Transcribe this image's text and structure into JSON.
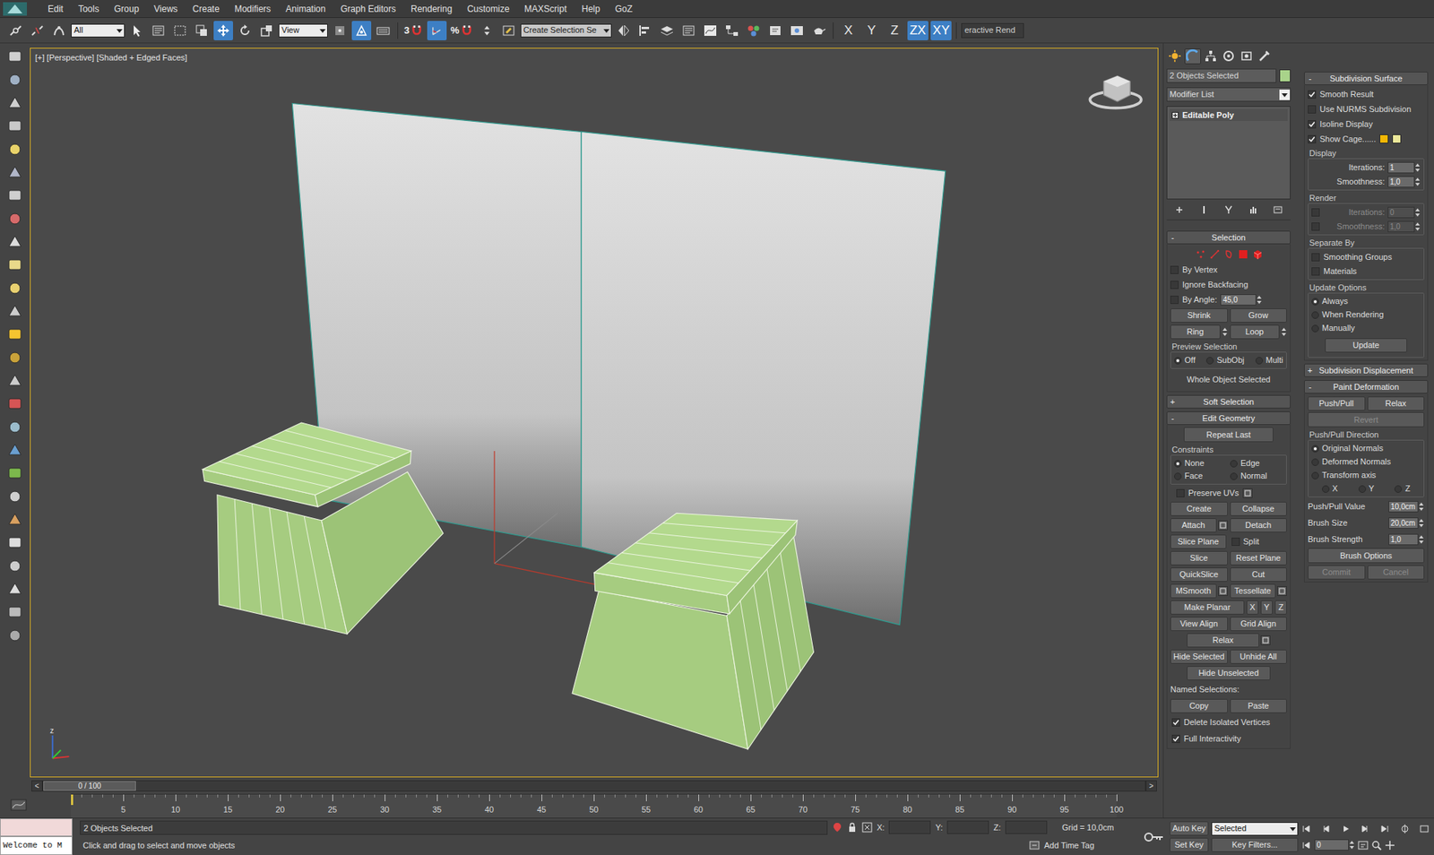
{
  "menu": {
    "items": [
      "Edit",
      "Tools",
      "Group",
      "Views",
      "Create",
      "Modifiers",
      "Animation",
      "Graph Editors",
      "Rendering",
      "Customize",
      "MAXScript",
      "Help",
      "GoZ"
    ]
  },
  "toolbar": {
    "selection_filter": "All",
    "transform_tools": [
      {
        "selected": true
      },
      {
        "selected": false
      },
      {
        "selected": false
      }
    ],
    "reference_coordinate": "View",
    "manipulate": {
      "selected": true
    },
    "snaps": [
      {
        "label": "3",
        "selected": false
      },
      {
        "selected": true
      },
      {
        "label": "%",
        "selected": false
      },
      {
        "selected": false
      }
    ],
    "named_selection": "Create Selection Se",
    "axis_constraints": [
      {
        "label": "X",
        "selected": false
      },
      {
        "label": "Y",
        "selected": false
      },
      {
        "label": "Z",
        "selected": false
      },
      {
        "label": "ZX",
        "selected": true
      },
      {
        "label": "XY",
        "selected": true
      }
    ],
    "renderer": "eractive Rend"
  },
  "viewport": {
    "label": "[+] [Perspective] [Shaded + Edged Faces]",
    "tripod_label": "z"
  },
  "command_panel": {
    "tabs": [
      {
        "selected": false
      },
      {
        "selected": true
      },
      {
        "selected": false
      },
      {
        "selected": false
      },
      {
        "selected": false
      },
      {
        "selected": false
      }
    ],
    "object_name": "2 Objects Selected",
    "object_color": "#a9d38a",
    "modifier_list": "Modifier List",
    "stack": [
      {
        "label": "Editable Poly",
        "expanded": false
      }
    ],
    "selection": {
      "title": "Selection",
      "toggle": "-",
      "checks": [
        {
          "label": "By Vertex",
          "checked": false
        },
        {
          "label": "Ignore Backfacing",
          "checked": false
        },
        {
          "label": "By Angle:",
          "checked": false,
          "value": "45,0"
        }
      ],
      "rows": [
        [
          {
            "kind": "button",
            "label": "Shrink"
          },
          {
            "kind": "button",
            "label": "Grow"
          }
        ],
        [
          {
            "kind": "spin_button",
            "label": "Ring"
          },
          {
            "kind": "spin_button",
            "label": "Loop"
          }
        ]
      ],
      "preview": {
        "title": "Preview Selection",
        "options": [
          {
            "label": "Off",
            "selected": true
          },
          {
            "label": "SubObj",
            "selected": false
          },
          {
            "label": "Multi",
            "selected": false
          }
        ]
      },
      "status": "Whole Object Selected"
    },
    "soft_selection": {
      "title": "Soft Selection",
      "toggle": "+"
    },
    "edit_geometry": {
      "title": "Edit Geometry",
      "toggle": "-",
      "repeat": "Repeat Last",
      "constraints": {
        "title": "Constraints",
        "options": [
          {
            "label": "None",
            "selected": true
          },
          {
            "label": "Edge",
            "selected": false
          },
          {
            "label": "Face",
            "selected": false
          },
          {
            "label": "Normal",
            "selected": false
          }
        ]
      },
      "preserve_uvs": {
        "label": "Preserve UVs",
        "checked": false
      },
      "rows": [
        [
          {
            "kind": "button",
            "label": "Create"
          },
          {
            "kind": "button",
            "label": "Collapse"
          }
        ],
        [
          {
            "kind": "button",
            "label": "Attach",
            "settings": true
          },
          {
            "kind": "button",
            "label": "Detach"
          }
        ],
        [
          {
            "kind": "button",
            "label": "Slice Plane"
          },
          {
            "kind": "check",
            "label": "Split",
            "checked": false
          }
        ],
        [
          {
            "kind": "button",
            "label": "Slice"
          },
          {
            "kind": "button",
            "label": "Reset Plane"
          }
        ],
        [
          {
            "kind": "button",
            "label": "QuickSlice"
          },
          {
            "kind": "button",
            "label": "Cut"
          }
        ],
        [
          {
            "kind": "button",
            "label": "MSmooth",
            "settings": true
          },
          {
            "kind": "button",
            "label": "Tessellate",
            "settings": true
          }
        ],
        [
          {
            "kind": "button",
            "label": "Make Planar"
          },
          {
            "kind": "axis",
            "label": "X"
          },
          {
            "kind": "axis",
            "label": "Y"
          },
          {
            "kind": "axis",
            "label": "Z"
          }
        ],
        [
          {
            "kind": "button",
            "label": "View Align"
          },
          {
            "kind": "button",
            "label": "Grid Align"
          }
        ],
        [
          {
            "kind": "button",
            "label": "Relax",
            "settings": true
          }
        ],
        [
          {
            "kind": "button",
            "label": "Hide Selected"
          },
          {
            "kind": "button",
            "label": "Unhide All"
          }
        ],
        [
          {
            "kind": "button",
            "label": "Hide Unselected"
          }
        ],
        [
          {
            "kind": "label",
            "label": "Named Selections:"
          }
        ],
        [
          {
            "kind": "button",
            "label": "Copy"
          },
          {
            "kind": "button",
            "label": "Paste"
          }
        ],
        [
          {
            "kind": "check",
            "label": "Delete Isolated Vertices",
            "checked": true
          }
        ],
        [
          {
            "kind": "check",
            "label": "Full Interactivity",
            "checked": true
          }
        ]
      ]
    },
    "subdivision_surface": {
      "title": "Subdivision Surface",
      "toggle": "-",
      "checks": [
        {
          "label": "Smooth Result",
          "checked": true
        },
        {
          "label": "Use NURMS Subdivision",
          "checked": false
        },
        {
          "label": "Isoline Display",
          "checked": true
        },
        {
          "label": "Show Cage......",
          "checked": true
        }
      ],
      "cage_colors": [
        {
          "color": "#f2b705"
        },
        {
          "color": "#ece89a"
        }
      ],
      "display": {
        "title": "Display",
        "spinners": [
          {
            "label": "Iterations:",
            "value": "1"
          },
          {
            "label": "Smoothness:",
            "value": "1,0"
          }
        ]
      },
      "render": {
        "title": "Render",
        "spinners": [
          {
            "label": "Iterations:",
            "value": "0",
            "checked": false,
            "disabled": true
          },
          {
            "label": "Smoothness:",
            "value": "1,0",
            "checked": false,
            "disabled": true
          }
        ]
      },
      "separate_by": {
        "title": "Separate By",
        "checks": [
          {
            "label": "Smoothing Groups",
            "checked": false
          },
          {
            "label": "Materials",
            "checked": false
          }
        ]
      },
      "update_options": {
        "title": "Update Options",
        "options": [
          {
            "label": "Always",
            "selected": true
          },
          {
            "label": "When Rendering",
            "selected": false
          },
          {
            "label": "Manually",
            "selected": false
          }
        ]
      },
      "update_button": "Update"
    },
    "subdivision_displacement": {
      "title": "Subdivision Displacement",
      "toggle": "+"
    },
    "paint_deformation": {
      "title": "Paint Deformation",
      "toggle": "-",
      "modes": [
        {
          "label": "Push/Pull",
          "selected": false
        },
        {
          "label": "Relax",
          "selected": false
        }
      ],
      "revert": {
        "label": "Revert",
        "disabled": true
      },
      "direction": {
        "title": "Push/Pull Direction",
        "options": [
          {
            "label": "Original Normals",
            "selected": true
          },
          {
            "label": "Deformed Normals",
            "selected": false
          },
          {
            "label": "Transform axis",
            "selected": false
          }
        ],
        "axes": [
          {
            "label": "X",
            "selected": false
          },
          {
            "label": "Y",
            "selected": false
          },
          {
            "label": "Z",
            "selected": false
          }
        ]
      },
      "spinners": [
        {
          "label": "Push/Pull Value",
          "value": "10,0cm"
        },
        {
          "label": "Brush Size",
          "value": "20,0cm"
        },
        {
          "label": "Brush Strength",
          "value": "1,0"
        }
      ],
      "brush_options": "Brush Options",
      "actions": [
        {
          "label": "Commit",
          "disabled": true
        },
        {
          "label": "Cancel",
          "disabled": true
        }
      ]
    }
  },
  "timeline": {
    "prev": "<",
    "next": ">",
    "frame": "0 / 100",
    "level": 0,
    "ticks": [
      "5",
      "10",
      "15",
      "20",
      "25",
      "30",
      "35",
      "40",
      "45",
      "50",
      "55",
      "60",
      "65",
      "70",
      "75",
      "80",
      "85",
      "90",
      "95",
      "100"
    ]
  },
  "status_bar": {
    "listener": "Welcome to M",
    "selection": "2 Objects Selected",
    "prompt": "Click and drag to select and move objects",
    "coords": [
      {
        "label": "X:"
      },
      {
        "label": "Y:"
      },
      {
        "label": "Z:"
      }
    ],
    "grid": "Grid = 10,0cm",
    "time_tag": "Add Time Tag",
    "auto_key": "Auto Key",
    "key_mode": "Selected",
    "set_key": "Set Key",
    "key_filters": "Key Filters...",
    "current_frame": "0"
  }
}
